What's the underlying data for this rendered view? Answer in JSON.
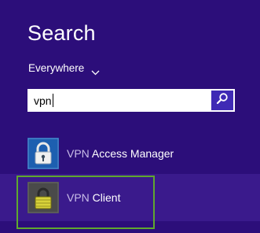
{
  "header": {
    "title": "Search"
  },
  "scope": {
    "label": "Everywhere",
    "icon": "chevron-down-icon"
  },
  "search": {
    "value": "vpn",
    "button_icon": "magnifier-icon"
  },
  "results": [
    {
      "match": "VPN",
      "rest": " Access Manager",
      "icon": "padlock-icon",
      "icon_bg": "#1d5fb0"
    },
    {
      "match": "VPN",
      "rest": " Client",
      "icon": "padlock-icon",
      "icon_bg": "#4a4a4a"
    }
  ],
  "colors": {
    "background": "#2c0e7a",
    "search_button": "#3f2ab5",
    "selected_row": "#3a1a8c",
    "highlight_frame": "#5fa82e"
  }
}
